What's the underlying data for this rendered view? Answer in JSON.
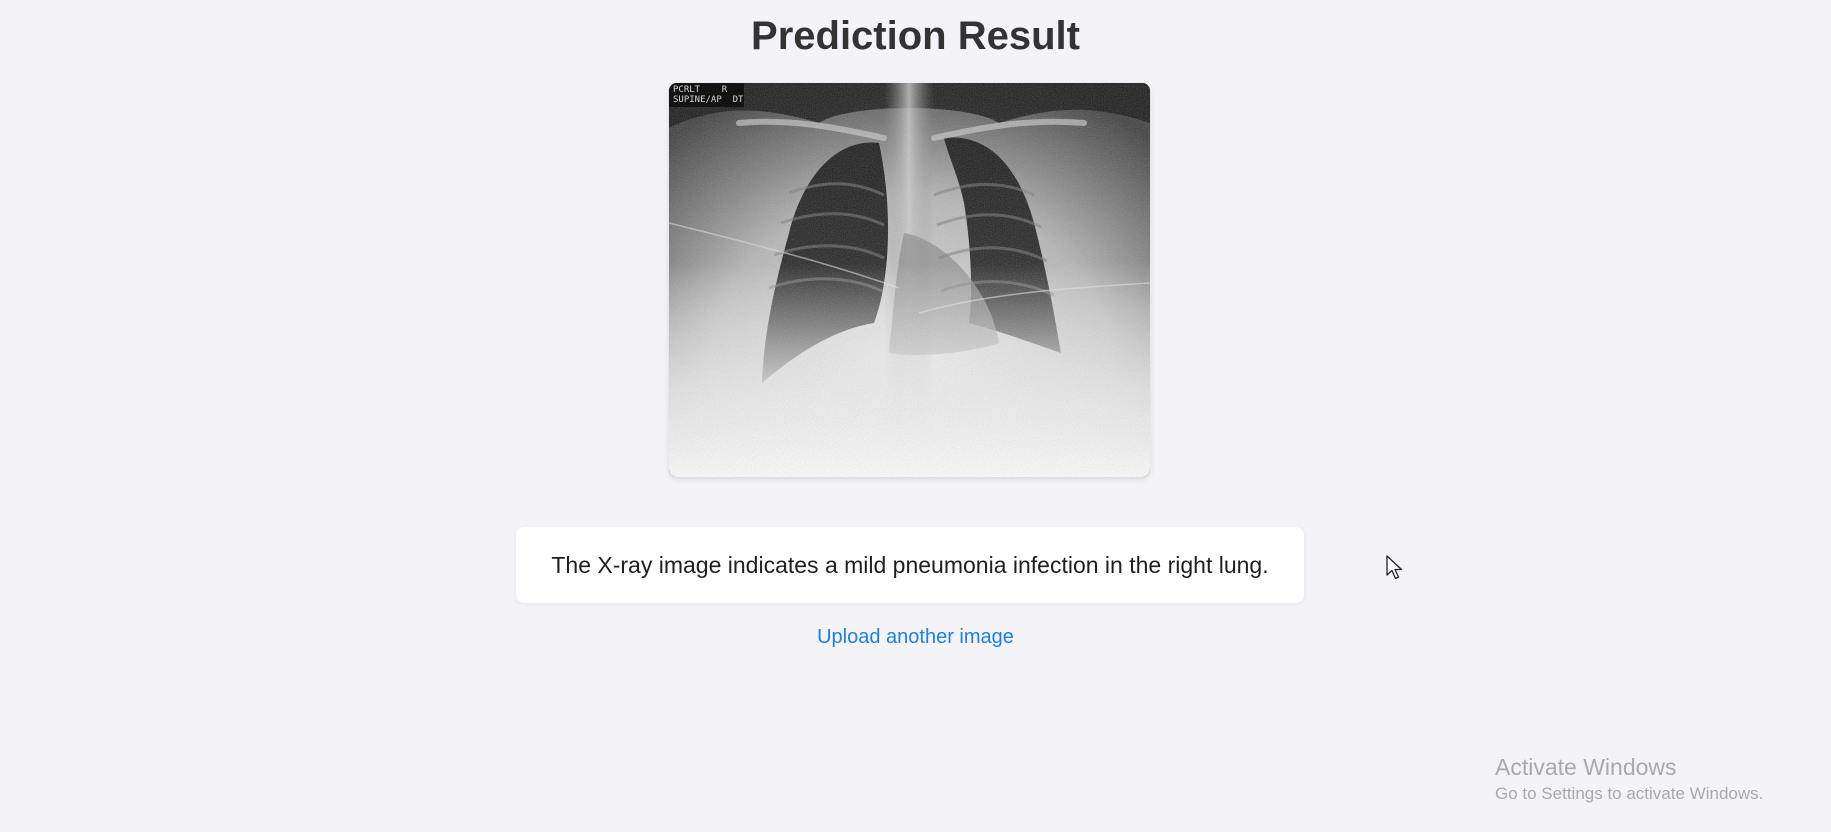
{
  "page": {
    "title": "Prediction Result",
    "background": "#f3f3f8"
  },
  "xray": {
    "label_line1": "PCRLT    R",
    "label_line2": "SUPINE/AP  DT"
  },
  "result": {
    "text": "The X-ray image indicates a mild pneumonia infection in the right lung."
  },
  "actions": {
    "upload_label": "Upload another image",
    "link_color": "#1e82d6"
  },
  "cursor": {
    "icon": "mouse-pointer-icon"
  },
  "watermark": {
    "title": "Activate Windows",
    "subtitle": "Go to Settings to activate Windows."
  }
}
